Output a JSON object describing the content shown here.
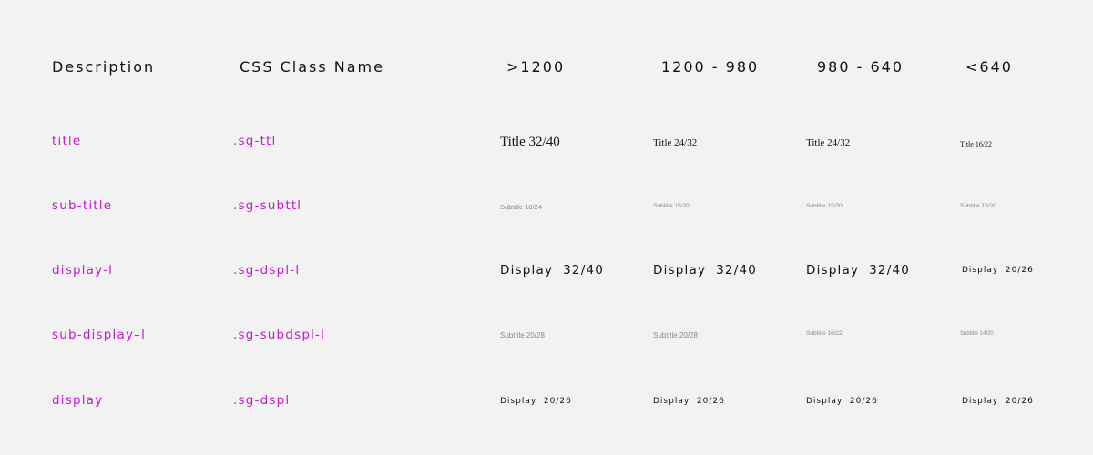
{
  "headers": {
    "description": "Description",
    "css_class": "CSS Class Name",
    "bp1": ">1200",
    "bp2": "1200 - 980",
    "bp3": "980 - 640",
    "bp4": "<640"
  },
  "rows": [
    {
      "description": "title",
      "css_class": ".sg-ttl",
      "bp1": "Title 32/40",
      "bp2": "Title 24/32",
      "bp3": "Title 24/32",
      "bp4": "Title 16/22"
    },
    {
      "description": "sub-title",
      "css_class": ".sg-subttl",
      "bp1": "Subtitle 18/24",
      "bp2": "Subtitle 15/20",
      "bp3": "Subtitle 15/20",
      "bp4": "Subtitle 15/20"
    },
    {
      "description": "display-l",
      "css_class": ".sg-dspl-l",
      "bp1": "Display  32/40",
      "bp2": "Display  32/40",
      "bp3": "Display  32/40",
      "bp4": "Display  20/26"
    },
    {
      "description": "sub-display–l",
      "css_class": ".sg-subdspl-l",
      "bp1": "Subtitle 20/28",
      "bp2": "Subtitle 20/28",
      "bp3": "Subtitle 16/22",
      "bp4": "Subtitle 14/20"
    },
    {
      "description": "display",
      "css_class": ".sg-dspl",
      "bp1": "Display  20/26",
      "bp2": "Display  20/26",
      "bp3": "Display  20/26",
      "bp4": "Display  20/26"
    }
  ],
  "colors": {
    "background": "#f2f2f2",
    "label_accent": "#c21ccf",
    "text": "#111111",
    "muted": "#8a8a8a"
  }
}
